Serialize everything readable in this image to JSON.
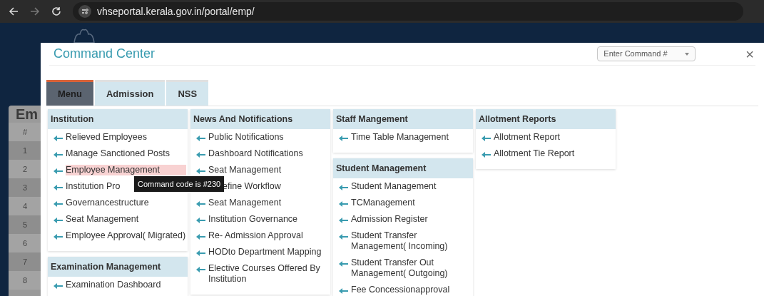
{
  "browser": {
    "url": "vhseportal.kerala.gov.in/portal/emp/"
  },
  "background_page": {
    "heading": "Em",
    "table_header": "#",
    "row_numbers": [
      "1",
      "2",
      "3",
      "4",
      "5",
      "6",
      "7",
      "8"
    ]
  },
  "modal": {
    "title": "Command Center",
    "command_select": {
      "placeholder": "Enter Command #"
    },
    "close": "×",
    "tabs": [
      {
        "label": "Menu",
        "selected": true
      },
      {
        "label": "Admission",
        "selected": false
      },
      {
        "label": "NSS",
        "selected": false
      }
    ],
    "columns": [
      [
        {
          "title": "Institution",
          "items": [
            {
              "label": "Relieved Employees",
              "selected": false
            },
            {
              "label": "Manage Sanctioned Posts",
              "selected": false
            },
            {
              "label": "Employee Management",
              "selected": true
            },
            {
              "label": "Institution Pro",
              "selected": false
            },
            {
              "label": "Governancestructure",
              "selected": false
            },
            {
              "label": "Seat Management",
              "selected": false
            },
            {
              "label": "Employee Approval( Migrated)",
              "selected": false
            }
          ]
        },
        {
          "title": "Examination Management",
          "items": [
            {
              "label": "Examination Dashboard",
              "selected": false
            }
          ]
        }
      ],
      [
        {
          "title": "News And Notifications",
          "items": [
            {
              "label": "Public Notifications",
              "selected": false
            },
            {
              "label": "Dashboard Notifications",
              "selected": false
            },
            {
              "label": "Seat Management",
              "selected": false
            },
            {
              "label": "efine Workflow",
              "selected": false,
              "icon_covered": true
            },
            {
              "label": "Seat Management",
              "selected": false
            },
            {
              "label": "Institution Governance",
              "selected": false
            },
            {
              "label": "Re- Admission Approval",
              "selected": false
            },
            {
              "label": "HODto Department Mapping",
              "selected": false
            },
            {
              "label": "Elective Courses Offered By Institution",
              "selected": false
            }
          ]
        }
      ],
      [
        {
          "title": "Staff Mangement",
          "items": [
            {
              "label": "Time Table Management",
              "selected": false
            }
          ]
        },
        {
          "title": "Student Management",
          "items": [
            {
              "label": "Student Management",
              "selected": false
            },
            {
              "label": "TCManagement",
              "selected": false
            },
            {
              "label": "Admission Register",
              "selected": false
            },
            {
              "label": "Student Transfer Management( Incoming)",
              "selected": false
            },
            {
              "label": "Student Transfer Out Management( Outgoing)",
              "selected": false
            },
            {
              "label": "Fee Concessionapproval",
              "selected": false
            }
          ]
        }
      ],
      [
        {
          "title": "Allotment Reports",
          "items": [
            {
              "label": "Allotment Report",
              "selected": false
            },
            {
              "label": "Allotment Tie Report",
              "selected": false
            }
          ]
        }
      ]
    ]
  },
  "tooltip": {
    "text": "Command code is #230"
  }
}
